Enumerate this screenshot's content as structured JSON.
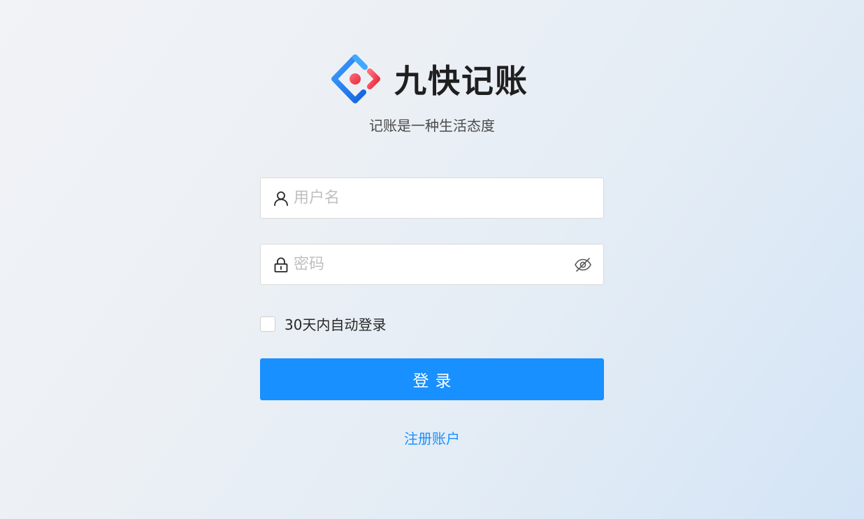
{
  "header": {
    "logo_icon": "diamond-logo-icon",
    "title": "九快记账",
    "subtitle": "记账是一种生活态度"
  },
  "form": {
    "username": {
      "icon": "user-icon",
      "value": "",
      "placeholder": "用户名"
    },
    "password": {
      "icon": "lock-icon",
      "value": "",
      "placeholder": "密码",
      "toggle_icon": "eye-invisible-icon"
    },
    "remember": {
      "checked": false,
      "label": "30天内自动登录"
    },
    "login_button": {
      "label": "登录"
    },
    "register_link": {
      "label": "注册账户"
    }
  },
  "colors": {
    "primary": "#1890ff",
    "logo_blue": "#1677ff",
    "logo_red": "#f5222d"
  }
}
